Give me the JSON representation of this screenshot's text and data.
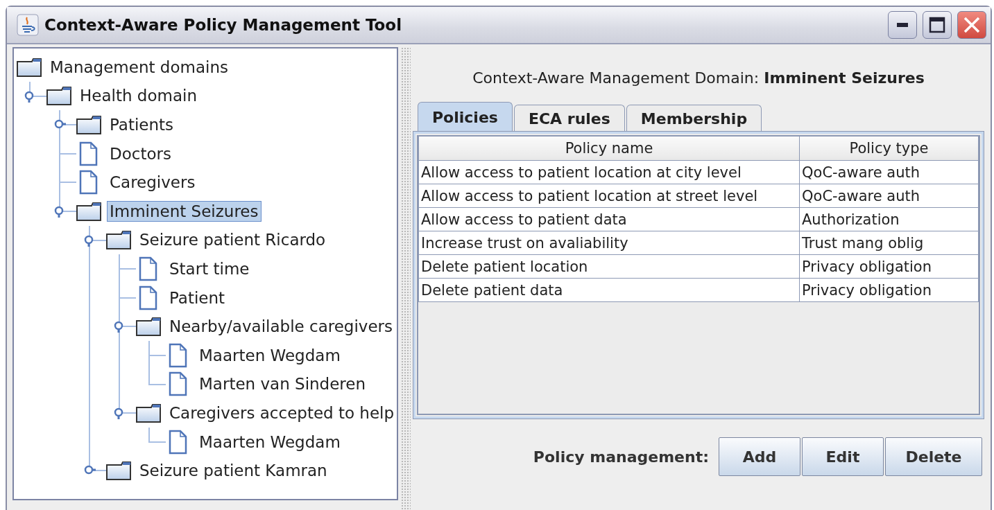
{
  "window": {
    "title": "Context-Aware Policy Management Tool"
  },
  "tree": {
    "kind": "folder",
    "label": "Management domains",
    "selected": false,
    "children": [
      {
        "kind": "folder",
        "label": "Health domain",
        "expanded": true,
        "selected": false,
        "children": [
          {
            "kind": "folder",
            "label": "Patients",
            "expanded": false,
            "selected": false
          },
          {
            "kind": "document",
            "label": "Doctors",
            "selected": false
          },
          {
            "kind": "document",
            "label": "Caregivers",
            "selected": false
          },
          {
            "kind": "folder",
            "label": "Imminent Seizures",
            "expanded": true,
            "selected": true,
            "children": [
              {
                "kind": "folder",
                "label": "Seizure patient Ricardo",
                "expanded": true,
                "selected": false,
                "children": [
                  {
                    "kind": "document",
                    "label": "Start time",
                    "selected": false
                  },
                  {
                    "kind": "document",
                    "label": "Patient",
                    "selected": false
                  },
                  {
                    "kind": "folder",
                    "label": "Nearby/available caregivers",
                    "expanded": true,
                    "selected": false,
                    "children": [
                      {
                        "kind": "document",
                        "label": "Maarten Wegdam",
                        "selected": false
                      },
                      {
                        "kind": "document",
                        "label": "Marten van Sinderen",
                        "selected": false
                      }
                    ]
                  },
                  {
                    "kind": "folder",
                    "label": "Caregivers accepted to help",
                    "expanded": true,
                    "selected": false,
                    "children": [
                      {
                        "kind": "document",
                        "label": "Maarten Wegdam",
                        "selected": false
                      }
                    ]
                  }
                ]
              },
              {
                "kind": "folder",
                "label": "Seizure patient Kamran",
                "expanded": false,
                "selected": false
              }
            ]
          }
        ]
      }
    ]
  },
  "domain_header": "Context-Aware Management Domain: **Imminent Seizures**",
  "tabs": [
    {
      "label": "Policies",
      "selected": true
    },
    {
      "label": "ECA rules",
      "selected": false
    },
    {
      "label": "Membership",
      "selected": false
    }
  ],
  "table": {
    "columns": [
      "Policy name",
      "Policy type"
    ],
    "rows": [
      [
        "Allow access to patient location at city level",
        "QoC-aware auth"
      ],
      [
        "Allow access to patient location at street level",
        "QoC-aware auth"
      ],
      [
        "Allow access to patient data",
        "Authorization"
      ],
      [
        "Increase trust on avaliability",
        "Trust mang oblig"
      ],
      [
        "Delete patient location",
        "Privacy obligation"
      ],
      [
        "Delete patient data",
        "Privacy obligation"
      ]
    ]
  },
  "footer": {
    "label": "Policy management:",
    "buttons": [
      "Add",
      "Edit",
      "Delete"
    ]
  }
}
